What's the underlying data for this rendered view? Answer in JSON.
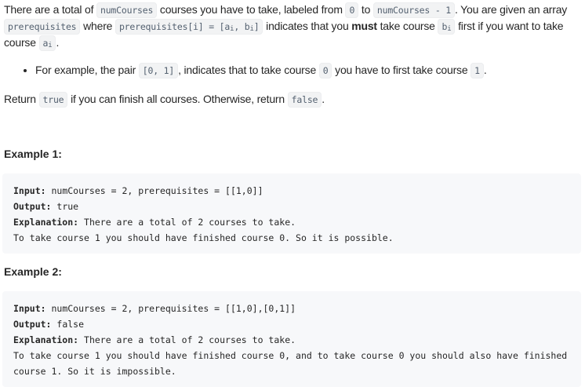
{
  "intro": {
    "t1": "There are a total of ",
    "c1": "numCourses",
    "t2": " courses you have to take, labeled from ",
    "c2": "0",
    "t3": " to ",
    "c3": "numCourses - 1",
    "t4": ". You are given an array ",
    "c4": "prerequisites",
    "t5": " where ",
    "c5": "prerequisites[i] = [a",
    "c5s1": "i",
    "c5b": ", b",
    "c5s2": "i",
    "c5c": "]",
    "t6": " indicates that you ",
    "bold": "must",
    "t7": " take course ",
    "c6": "b",
    "c6s": "i",
    "t8": " first if you want to take course ",
    "c7": "a",
    "c7s": "i",
    "t9": "."
  },
  "bullet": {
    "t1": "For example, the pair ",
    "c1": "[0, 1]",
    "t2": ", indicates that to take course ",
    "c2": "0",
    "t3": " you have to first take course ",
    "c3": "1",
    "t4": "."
  },
  "return_line": {
    "t1": "Return ",
    "c1": "true",
    "t2": " if you can finish all courses. Otherwise, return ",
    "c2": "false",
    "t3": "."
  },
  "examples": [
    {
      "title": "Example 1:",
      "input_label": "Input:",
      "input": " numCourses = 2, prerequisites = [[1,0]]",
      "output_label": "Output:",
      "output": " true",
      "explanation_label": "Explanation:",
      "explanation": " There are a total of 2 courses to take.\nTo take course 1 you should have finished course 0. So it is possible."
    },
    {
      "title": "Example 2:",
      "input_label": "Input:",
      "input": " numCourses = 2, prerequisites = [[1,0],[0,1]]",
      "output_label": "Output:",
      "output": " false",
      "explanation_label": "Explanation:",
      "explanation": " There are a total of 2 courses to take.\nTo take course 1 you should have finished course 0, and to take course 0 you should also have finished course 1. So it is impossible."
    }
  ]
}
